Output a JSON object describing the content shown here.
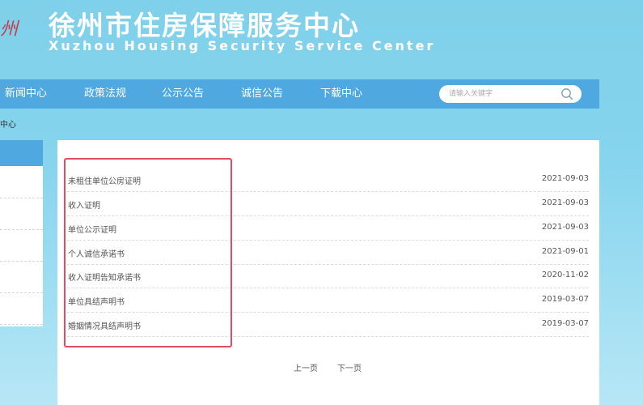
{
  "header": {
    "logo_text": "州",
    "title_cn": "徐州市住房保障服务中心",
    "title_en": "Xuzhou Housing Security Service Center"
  },
  "nav": {
    "items": [
      "新闻中心",
      "政策法规",
      "公示公告",
      "诚信公告",
      "下载中心"
    ],
    "search_placeholder": "请输入关键字",
    "search_icon": "search-icon"
  },
  "breadcrumb": "中心",
  "list": {
    "rows": [
      {
        "title": "未租住单位公房证明",
        "date": "2021-09-03"
      },
      {
        "title": "收入证明",
        "date": "2021-09-03"
      },
      {
        "title": "单位公示证明",
        "date": "2021-09-03"
      },
      {
        "title": "个人诚信承诺书",
        "date": "2021-09-01"
      },
      {
        "title": "收入证明告知承诺书",
        "date": "2020-11-02"
      },
      {
        "title": "单位具结声明书",
        "date": "2019-03-07"
      },
      {
        "title": "婚姻情况具结声明书",
        "date": "2019-03-07"
      }
    ]
  },
  "pager": {
    "prev": "上一页",
    "next": "下一页"
  },
  "colors": {
    "nav": "#4fa8e0",
    "highlight": "#e04d63",
    "background": "#86d4ee"
  }
}
